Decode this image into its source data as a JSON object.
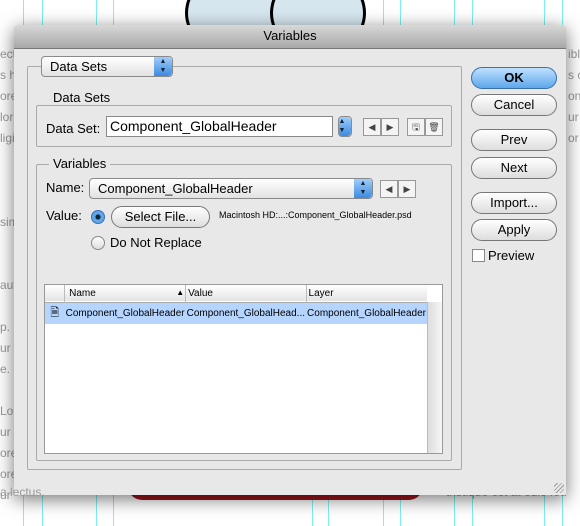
{
  "window": {
    "title": "Variables"
  },
  "background": {
    "left_lines": [
      "ect",
      "s h",
      "ore",
      "lor",
      "ligi",
      "",
      "",
      "",
      "sim",
      "",
      "",
      "aut",
      "",
      "p. D",
      "ur",
      "e. L",
      "",
      "Lo",
      "ur",
      "ore",
      "ore",
      "ur",
      "a lectus."
    ],
    "right_lines": [
      "ibl",
      "s c",
      "on",
      "ur",
      "or",
      "",
      "",
      "",
      "",
      "",
      "",
      "",
      "",
      "",
      "",
      "",
      "",
      "",
      "",
      "",
      "",
      "",
      "tristique est at odio feu"
    ]
  },
  "mode_popup": "Data Sets",
  "datasets": {
    "group_label": "Data Sets",
    "field_label": "Data Set:",
    "value": "Component_GlobalHeader"
  },
  "variables": {
    "group_label": "Variables",
    "name_label": "Name:",
    "name_value": "Component_GlobalHeader",
    "value_label": "Value:",
    "select_file": "Select File...",
    "file_path": "Macintosh HD:...:Component_GlobalHeader.psd",
    "do_not_replace": "Do Not Replace",
    "selected_option": "select-file"
  },
  "table": {
    "columns": [
      "Name",
      "Value",
      "Layer"
    ],
    "sort_column": "Name",
    "rows": [
      {
        "name": "Component_GlobalHeader",
        "value": "Component_GlobalHead...",
        "layer": "Component_GlobalHeader",
        "selected": true
      }
    ]
  },
  "buttons": {
    "ok": "OK",
    "cancel": "Cancel",
    "prev": "Prev",
    "next": "Next",
    "import": "Import...",
    "apply": "Apply"
  },
  "preview": {
    "label": "Preview",
    "checked": false
  },
  "colors": {
    "accent": "#5ea7ea",
    "selection": "#b5d5ff",
    "guide": "#7ff0f0"
  }
}
